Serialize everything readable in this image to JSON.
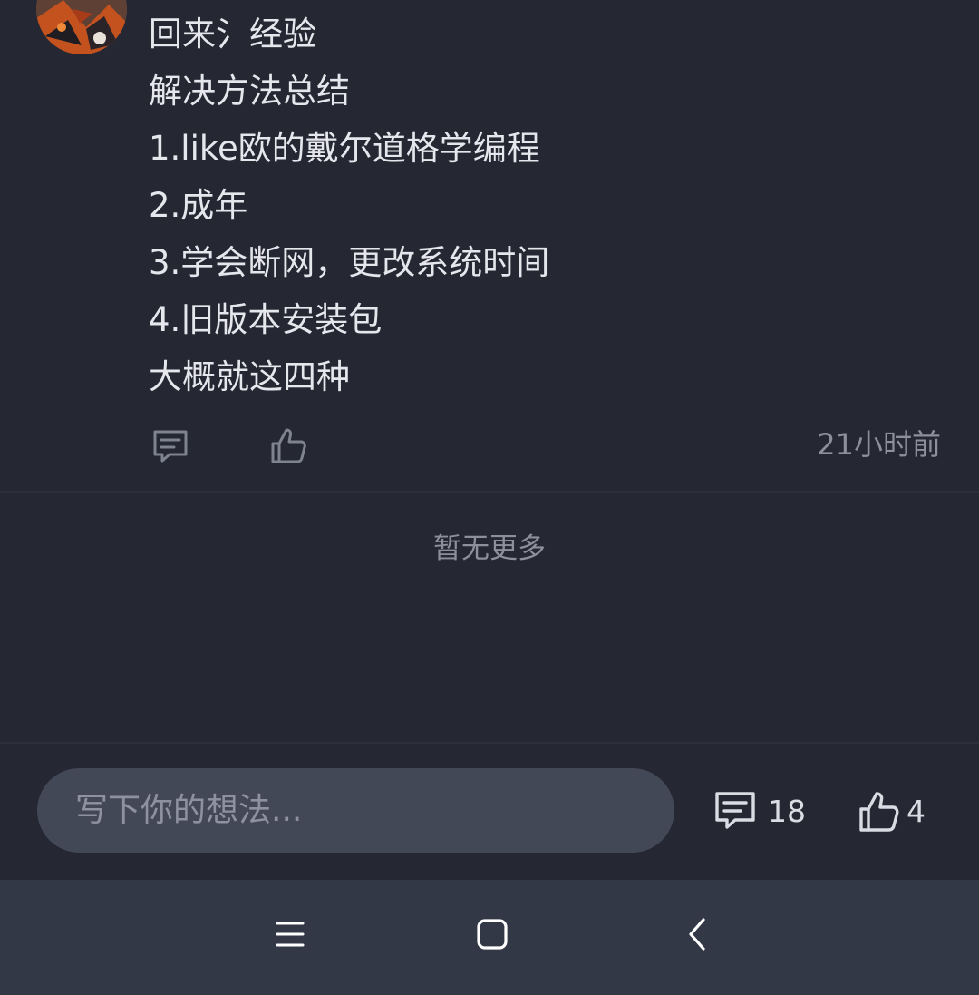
{
  "comment": {
    "lines": [
      "回来氵经验",
      "解决方法总结",
      "1.like欧的戴尔道格学编程",
      "2.成年",
      "3.学会断网，更改系统时间",
      "4.旧版本安装包",
      "大概就这四种"
    ],
    "timestamp": "21小时前"
  },
  "feed": {
    "end_text": "暂无更多"
  },
  "composer": {
    "placeholder": "写下你的想法...",
    "comment_count": "18",
    "like_count": "4"
  },
  "icons": {
    "reply": "comment-bubble-icon",
    "like": "thumbs-up-icon",
    "nav_menu": "menu-icon",
    "nav_home": "home-icon",
    "nav_back": "back-icon"
  },
  "colors": {
    "background": "#252733",
    "input_background": "#434857",
    "nav_background": "#333847",
    "text_primary": "#e6e7ec",
    "text_secondary": "#8d909b"
  }
}
